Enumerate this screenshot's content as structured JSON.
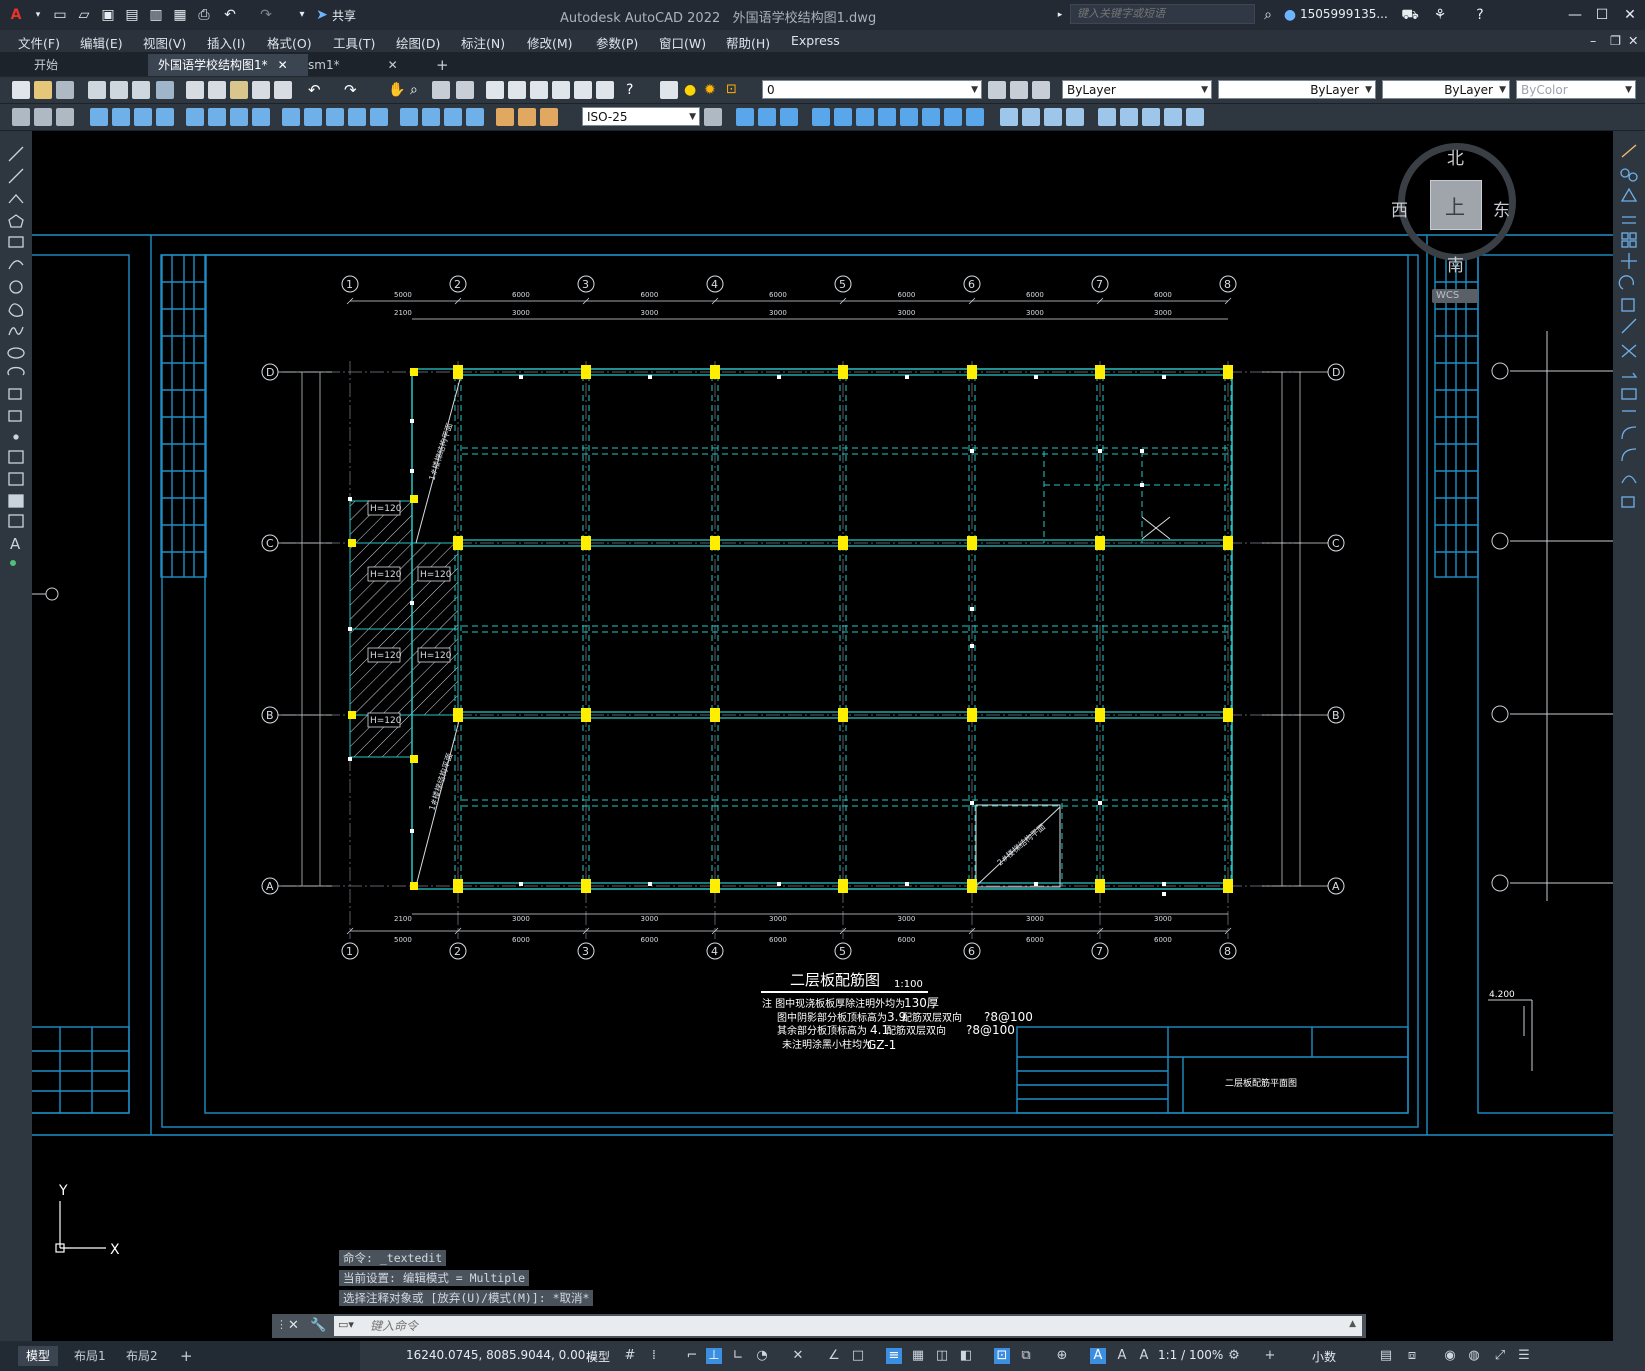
{
  "app": {
    "title": "Autodesk AutoCAD 2022",
    "file": "外国语学校结构图1.dwg",
    "share": "共享",
    "search_placeholder": "键入关键字或短语",
    "user": "1505999135..."
  },
  "menus": [
    "文件(F)",
    "编辑(E)",
    "视图(V)",
    "插入(I)",
    "格式(O)",
    "工具(T)",
    "绘图(D)",
    "标注(N)",
    "修改(M)",
    "参数(P)",
    "窗口(W)",
    "帮助(H)",
    "Express"
  ],
  "tabs": [
    {
      "label": "开始"
    },
    {
      "label": "外国语学校结构图1*"
    },
    {
      "label": "sm1*"
    }
  ],
  "toolbar": {
    "layer": "0",
    "color": "ByLayer",
    "linetype": "ByLayer",
    "lineweight": "ByLayer",
    "plotstyle": "ByColor",
    "dimstyle": "ISO-25"
  },
  "viewcube": {
    "north": "北",
    "south": "南",
    "east": "东",
    "west": "西",
    "top": "上",
    "wcs": "WCS"
  },
  "drawing": {
    "title": "二层板配筋图",
    "scale": "1:100",
    "grid_numbers": [
      "1",
      "2",
      "3",
      "4",
      "5",
      "6",
      "7",
      "8"
    ],
    "grid_letters": [
      "D",
      "C",
      "B",
      "A"
    ],
    "top_spans": [
      "5000",
      "6000",
      "6000",
      "6000",
      "6000",
      "6000",
      "6000"
    ],
    "sub_dims": [
      "2100",
      "3000",
      "3000",
      "3000",
      "3000",
      "3000",
      "3000"
    ],
    "slab_label": "H=120",
    "stair1": "1#楼梯结构平面",
    "stair2": "2#楼梯结构平面",
    "notes": {
      "n1": "注 图中现浇板板厚除注明外均为",
      "n1v": "130厚",
      "n2": "图中阴影部分板顶标高为",
      "n2v": "3.9",
      "n2b": "配筋双层双向",
      "n2r": "?8@100",
      "n3": "其余部分板顶标高为",
      "n3v": "4.1",
      "n3b": "配筋双层双向",
      "n3r": "?8@100",
      "n4": "未注明涂黑小柱均为",
      "n4v": "GZ-1"
    },
    "titleblock_text": "二层板配筋平面图",
    "elev": "4.200"
  },
  "command": {
    "line1": "命令: _textedit",
    "line2": "当前设置: 编辑模式 = Multiple",
    "line3": "选择注释对象或 [放弃(U)/模式(M)]: *取消*",
    "placeholder": "键入命令"
  },
  "layout_tabs": [
    "模型",
    "布局1",
    "布局2"
  ],
  "status": {
    "coords": "16240.0745, 8085.9044, 0.00...",
    "space": "模型",
    "scale": "1:1 / 100%",
    "units": "小数"
  },
  "ucs": {
    "x": "X",
    "y": "Y"
  }
}
